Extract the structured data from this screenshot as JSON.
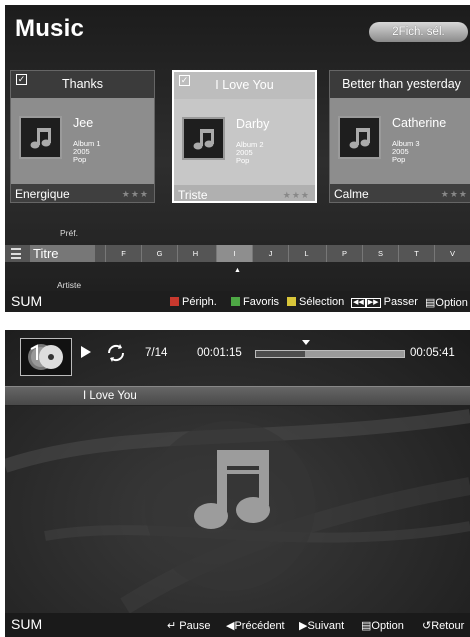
{
  "browser": {
    "title": "Music",
    "select_button": "2Fich. sél.",
    "cards": [
      {
        "track": "Thanks",
        "artist": "Jee",
        "album": "Album 1",
        "year": "2005",
        "genre": "Pop",
        "mood": "Energique",
        "checked": true
      },
      {
        "track": "I Love You",
        "artist": "Darby",
        "album": "Album 2",
        "year": "2005",
        "genre": "Pop",
        "mood": "Triste",
        "checked": true
      },
      {
        "track": "Better than yesterday",
        "artist": "Catherine",
        "album": "Album 3",
        "year": "2005",
        "genre": "Pop",
        "mood": "Calme",
        "checked": false
      }
    ],
    "stars": "★★★",
    "sort": {
      "previous": "Préf.",
      "current": "Titre",
      "next": "Artiste",
      "letters": [
        "F",
        "G",
        "H",
        "I",
        "J",
        "L",
        "P",
        "S",
        "T",
        "V"
      ],
      "active_letter": "I"
    },
    "footer": {
      "sum": "SUM",
      "device": "Périph.",
      "favorites": "Favoris",
      "selection": "Sélection",
      "skip": "Passer",
      "option": "Option"
    }
  },
  "player": {
    "track_index": "7/14",
    "elapsed": "00:01:15",
    "total": "00:05:41",
    "progress_fraction": 0.33,
    "title": "I Love You",
    "footer": {
      "sum": "SUM",
      "pause": "Pause",
      "previous": "Précédent",
      "next": "Suivant",
      "option": "Option",
      "return": "Retour"
    }
  },
  "colors": {
    "red_key": "#c8392e",
    "green_key": "#4ea845",
    "yellow_key": "#d9c63a",
    "blue_key": "#3a6ac8"
  },
  "icons": [
    "music-note-icon",
    "checkbox-icon",
    "menu-icon",
    "disc-icon",
    "play-icon",
    "repeat-icon",
    "enter-icon",
    "arrow-left-icon",
    "arrow-right-icon",
    "option-icon",
    "return-icon"
  ]
}
